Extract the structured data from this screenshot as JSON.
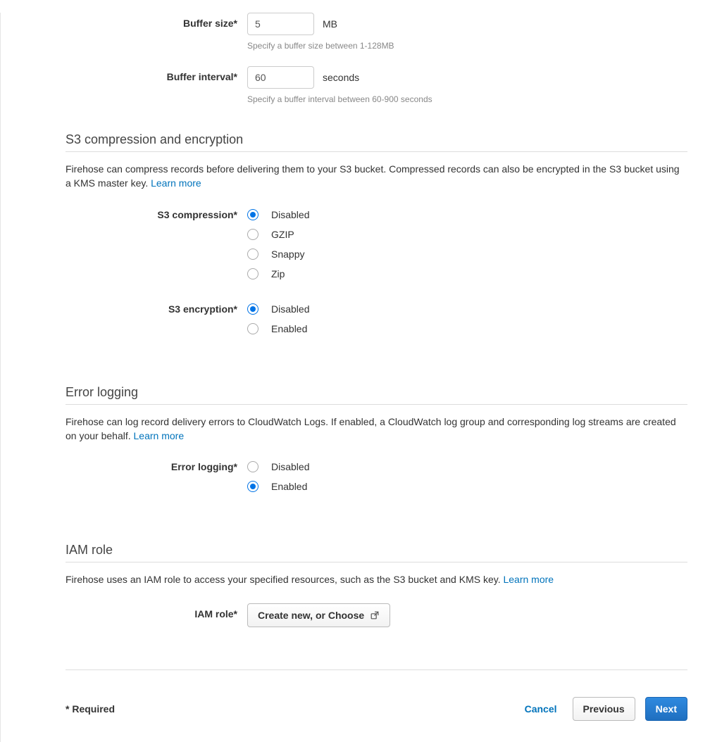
{
  "buffer": {
    "size_label": "Buffer size*",
    "size_value": "5",
    "size_unit": "MB",
    "size_help": "Specify a buffer size between 1-128MB",
    "interval_label": "Buffer interval*",
    "interval_value": "60",
    "interval_unit": "seconds",
    "interval_help": "Specify a buffer interval between 60-900 seconds"
  },
  "compression_section": {
    "title": "S3 compression and encryption",
    "desc": "Firehose can compress records before delivering them to your S3 bucket. Compressed records can also be encrypted in the S3 bucket using a KMS master key. ",
    "learn_more": "Learn more",
    "compression_label": "S3 compression*",
    "compression_options": [
      "Disabled",
      "GZIP",
      "Snappy",
      "Zip"
    ],
    "compression_selected": 0,
    "encryption_label": "S3 encryption*",
    "encryption_options": [
      "Disabled",
      "Enabled"
    ],
    "encryption_selected": 0
  },
  "error_section": {
    "title": "Error logging",
    "desc": "Firehose can log record delivery errors to CloudWatch Logs. If enabled, a CloudWatch log group and corresponding log streams are created on your behalf. ",
    "learn_more": "Learn more",
    "label": "Error logging*",
    "options": [
      "Disabled",
      "Enabled"
    ],
    "selected": 1
  },
  "iam_section": {
    "title": "IAM role",
    "desc": "Firehose uses an IAM role to access your specified resources, such as the S3 bucket and KMS key. ",
    "learn_more": "Learn more",
    "label": "IAM role*",
    "button": "Create new, or Choose"
  },
  "footer": {
    "required": "* Required",
    "cancel": "Cancel",
    "previous": "Previous",
    "next": "Next"
  }
}
